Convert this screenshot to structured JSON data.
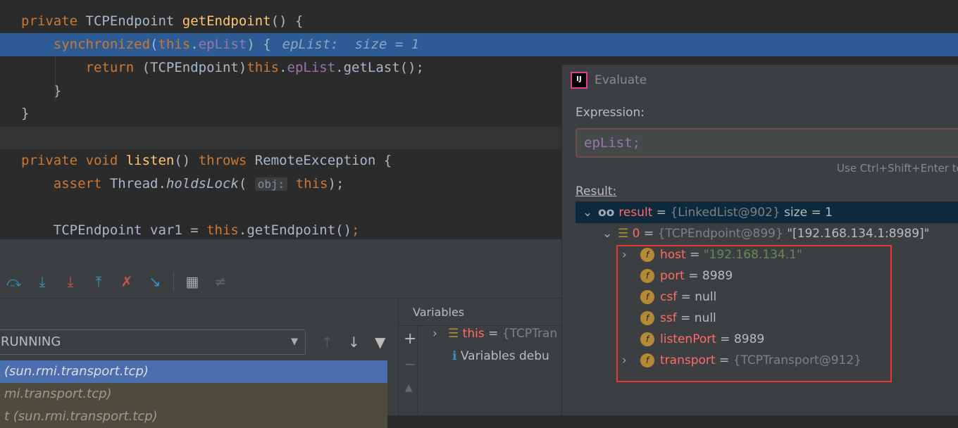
{
  "editor": {
    "lines": [
      {
        "parts": [
          [
            "kw",
            "private "
          ],
          [
            "",
            "TCPEndpoint "
          ],
          [
            "fn",
            "getEndpoint"
          ],
          [
            "",
            "() {"
          ]
        ]
      },
      {
        "parts": [
          [
            "kw",
            "    synchronized"
          ],
          [
            "",
            "("
          ],
          [
            "kw",
            "this"
          ],
          [
            "",
            "."
          ],
          [
            "fd",
            "epList"
          ],
          [
            "",
            ") {"
          ]
        ],
        "hint": "epList:  size = 1"
      },
      {
        "parts": [
          [
            "kw",
            "        return "
          ],
          [
            "",
            "(TCPEndpoint)"
          ],
          [
            "kw",
            "this"
          ],
          [
            "",
            "."
          ],
          [
            "fd",
            "epList"
          ],
          [
            "",
            ".getLast();"
          ]
        ]
      },
      {
        "parts": [
          [
            "",
            "    }"
          ]
        ]
      },
      {
        "parts": [
          [
            "",
            "}"
          ]
        ]
      },
      {
        "parts": []
      },
      {
        "parts": [
          [
            "kw",
            "private void "
          ],
          [
            "fn",
            "listen"
          ],
          [
            "",
            "() "
          ],
          [
            "kw",
            "throws "
          ],
          [
            "",
            "RemoteException {"
          ]
        ]
      },
      {
        "parts": [
          [
            "kw",
            "    assert "
          ],
          [
            "",
            "Thread."
          ],
          [
            "it",
            "holdsLock"
          ],
          [
            "",
            "( "
          ],
          [
            "param",
            "obj:"
          ],
          [
            "kw",
            " this"
          ],
          [
            "",
            ");"
          ]
        ]
      },
      {
        "parts": []
      },
      {
        "parts": [
          [
            "",
            "    TCPEndpoint var1 = "
          ],
          [
            "kw",
            "this"
          ],
          [
            "",
            ".getEndpoint()"
          ],
          [
            "kw",
            ";"
          ]
        ]
      }
    ]
  },
  "debugger": {
    "thread_combo": "RUNNING",
    "frames": [
      "(sun.rmi.transport.tcp)",
      "mi.transport.tcp)",
      "t (sun.rmi.transport.tcp)"
    ],
    "variables_title": "Variables",
    "this_name": "this",
    "this_value": "{TCPTran",
    "info": "Variables debu"
  },
  "evaluate": {
    "title": "Evaluate",
    "expression_label": "Expression:",
    "expression": "epList;",
    "hint": "Use Ctrl+Shift+Enter to",
    "result_label": "Result:",
    "rows": [
      {
        "name": "result",
        "value": "{LinkedList@902}",
        "extra": " size = 1"
      },
      {
        "name": "0",
        "value": "{TCPEndpoint@899}",
        "extra": " \"[192.168.134.1:8989]\""
      },
      {
        "name": "host",
        "value": "\"192.168.134.1\""
      },
      {
        "name": "port",
        "value": "8989"
      },
      {
        "name": "csf",
        "value": "null"
      },
      {
        "name": "ssf",
        "value": "null"
      },
      {
        "name": "listenPort",
        "value": "8989"
      },
      {
        "name": "transport",
        "value": "{TCPTransport@912}"
      }
    ]
  },
  "colors": {
    "keyword": "#cc7832",
    "method": "#ffc66d",
    "field": "#9876aa",
    "highlight": "#2d5b96",
    "annotation_box": "#e53935"
  }
}
